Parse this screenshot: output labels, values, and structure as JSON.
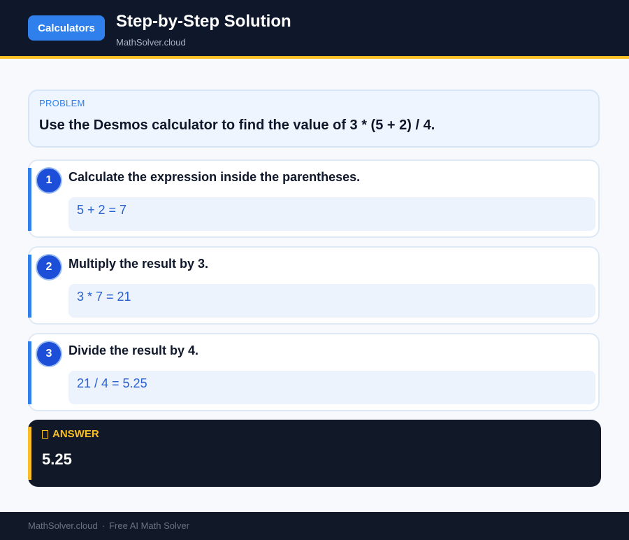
{
  "header": {
    "calculators_button": "Calculators",
    "title": "Step-by-Step Solution",
    "subtitle": "MathSolver.cloud"
  },
  "problem": {
    "label": "PROBLEM",
    "text": "Use the Desmos calculator to find the value of 3 * (5 + 2) / 4."
  },
  "steps": [
    {
      "number": "1",
      "title": "Calculate the expression inside the parentheses.",
      "calc": "5 + 2 = 7"
    },
    {
      "number": "2",
      "title": "Multiply the result by 3.",
      "calc": "3 * 7 = 21"
    },
    {
      "number": "3",
      "title": "Divide the result by 4.",
      "calc": "21 / 4 = 5.25"
    }
  ],
  "answer": {
    "icon": "checkbox-icon",
    "label": "ANSWER",
    "value": "5.25"
  },
  "footer": {
    "site": "MathSolver.cloud",
    "separator": "·",
    "tagline": "Free AI Math Solver"
  },
  "colors": {
    "header_bg": "#0f172a",
    "accent_gold": "#fbbf24",
    "accent_blue": "#2f80ed",
    "step_number_bg": "#1d4ed8"
  }
}
